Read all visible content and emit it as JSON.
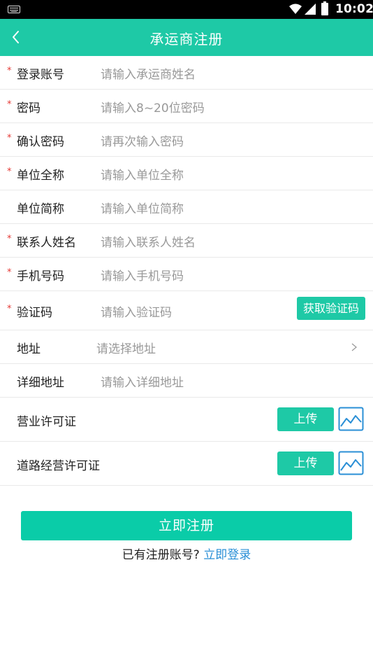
{
  "status_bar": {
    "time": "10:02"
  },
  "app_bar": {
    "title": "承运商注册"
  },
  "form": {
    "required_mark": "*",
    "fields": [
      {
        "label": "登录账号",
        "placeholder": "请输入承运商姓名",
        "required": true
      },
      {
        "label": "密码",
        "placeholder": "请输入8~20位密码",
        "required": true
      },
      {
        "label": "确认密码",
        "placeholder": "请再次输入密码",
        "required": true
      },
      {
        "label": "单位全称",
        "placeholder": "请输入单位全称",
        "required": true
      },
      {
        "label": "单位简称",
        "placeholder": "请输入单位简称",
        "required": false
      },
      {
        "label": "联系人姓名",
        "placeholder": "请输入联系人姓名",
        "required": true
      },
      {
        "label": "手机号码",
        "placeholder": "请输入手机号码",
        "required": true
      },
      {
        "label": "验证码",
        "placeholder": "请输入验证码",
        "required": true,
        "button": "获取验证码"
      },
      {
        "label": "地址",
        "placeholder": "请选择地址",
        "required": false
      },
      {
        "label": "详细地址",
        "placeholder": "请输入详细地址",
        "required": false
      }
    ],
    "uploads": [
      {
        "label": "营业许可证",
        "button": "上传",
        "icon": "image-icon"
      },
      {
        "label": "道路经营许可证",
        "button": "上传",
        "icon": "image-icon"
      }
    ]
  },
  "register_button": "立即注册",
  "login_prompt": {
    "text": "已有注册账号?",
    "link": "立即登录"
  },
  "colors": {
    "accent": "#1ec9a6",
    "required": "#e53935",
    "link": "#2a8fd6",
    "placeholder": "#999999"
  }
}
